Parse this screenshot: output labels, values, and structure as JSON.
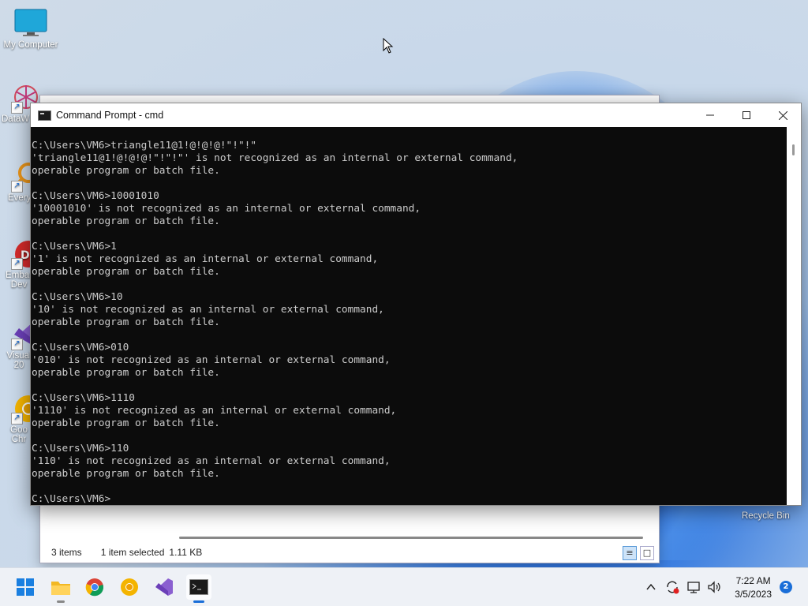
{
  "desktop": {
    "icons": [
      {
        "label": "My Computer",
        "icon": "monitor-icon"
      },
      {
        "label": "DataW",
        "icon": "datawarehouse-icon"
      },
      {
        "label": "Every",
        "icon": "everything-search-icon"
      },
      {
        "label": "Embar Dev",
        "icon": "embarcadero-icon"
      },
      {
        "label": "Visual 20",
        "icon": "visual-studio-icon"
      },
      {
        "label": "Goo Chr",
        "icon": "chrome-canary-icon"
      }
    ],
    "recycle_bin": "Recycle Bin"
  },
  "explorer": {
    "items_count": "3 items",
    "selected": "1 item selected",
    "size": "1.11 KB"
  },
  "cmd": {
    "title": "Command Prompt - cmd",
    "output": "C:\\Users\\VM6>triangle11@1!@!@!@!\"!\"!\"\n'triangle11@1!@!@!@!\"!\"!\"' is not recognized as an internal or external command,\noperable program or batch file.\n\nC:\\Users\\VM6>10001010\n'10001010' is not recognized as an internal or external command,\noperable program or batch file.\n\nC:\\Users\\VM6>1\n'1' is not recognized as an internal or external command,\noperable program or batch file.\n\nC:\\Users\\VM6>10\n'10' is not recognized as an internal or external command,\noperable program or batch file.\n\nC:\\Users\\VM6>010\n'010' is not recognized as an internal or external command,\noperable program or batch file.\n\nC:\\Users\\VM6>1110\n'1110' is not recognized as an internal or external command,\noperable program or batch file.\n\nC:\\Users\\VM6>110\n'110' is not recognized as an internal or external command,\noperable program or batch file.\n\nC:\\Users\\VM6>"
  },
  "taskbar": {
    "apps": [
      "start-icon",
      "file-explorer-icon",
      "chrome-icon",
      "chrome-canary-icon",
      "visual-studio-icon",
      "command-prompt-icon"
    ],
    "time": "7:22 AM",
    "date": "3/5/2023",
    "notifications": "2"
  }
}
